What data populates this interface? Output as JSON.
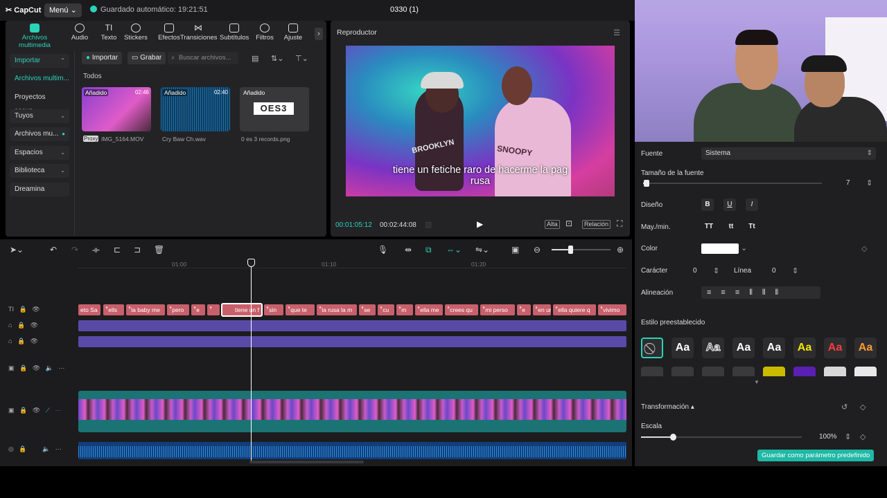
{
  "app": {
    "logo": "CapCut",
    "menu_label": "Menú",
    "autosave": "Guardado automático: 19:21:51",
    "project_name": "0330 (1)"
  },
  "toolbar": {
    "items": [
      {
        "label": "Archivos multimedia",
        "icon": "media-icon",
        "active": true
      },
      {
        "label": "Audio",
        "icon": "audio-icon"
      },
      {
        "label": "Texto",
        "icon": "text-icon"
      },
      {
        "label": "Stickers",
        "icon": "sticker-icon"
      },
      {
        "label": "Efectos",
        "icon": "effects-icon"
      },
      {
        "label": "Transiciones",
        "icon": "transitions-icon"
      },
      {
        "label": "Subtítulos",
        "icon": "subtitles-icon"
      },
      {
        "label": "Filtros",
        "icon": "filters-icon"
      },
      {
        "label": "Ajuste",
        "icon": "adjust-icon"
      }
    ],
    "next_arrow": "›"
  },
  "sidebar": {
    "items": [
      {
        "label": "Importar",
        "chev": "⌃"
      },
      {
        "label": "Archivos multim..."
      },
      {
        "label": "Proyectos secun..."
      },
      {
        "label": "Tuyos",
        "chev": "⌄"
      },
      {
        "label": "Archivos mu...",
        "chev": "●"
      },
      {
        "label": "Espacios",
        "chev": "⌄"
      },
      {
        "label": "Biblioteca",
        "chev": "⌄"
      },
      {
        "label": "Dreamina"
      }
    ]
  },
  "media": {
    "import_label": "Importar",
    "record_label": "Grabar",
    "search_placeholder": "Buscar archivos...",
    "section": "Todos",
    "files": [
      {
        "tag": "Añadido",
        "duration": "02:46",
        "name": "IMG_5164.MOV",
        "proxy": "Proxy"
      },
      {
        "tag": "Añadido",
        "duration": "02:40",
        "name": "Cry Baw Ch.wav"
      },
      {
        "tag": "Añadido",
        "name": "0 es 3 records.png",
        "logo_text": "OES3"
      }
    ]
  },
  "player": {
    "title": "Reproductor",
    "subtitle_line1": "tiene un fetiche raro de hacerme la pag",
    "subtitle_line2": "rusa",
    "shirt_text": "BROOKLYN",
    "shirt_text2": "SNOOPY",
    "current_time": "00:01:05:12",
    "total_time": "00:02:44:08",
    "quality_btn": "Alta",
    "ratio_btn": "Relación"
  },
  "timeline": {
    "ticks": [
      "01:00",
      "01:10",
      "01:20"
    ],
    "caption_segments": [
      "eto Sa",
      "ells",
      "la baby me",
      "pero",
      "e",
      "",
      "sin",
      "que te",
      "la rusa la m",
      "se",
      "cu",
      "m",
      "ella me",
      "crees qu",
      "mi perso",
      "e",
      "en un",
      "ella quiere q",
      "vivimo"
    ],
    "selected_segment": "tiene un f"
  },
  "properties": {
    "font_label": "Fuente",
    "font_value": "Sistema",
    "font_size_label": "Tamaño de la fuente",
    "font_size_value": "7",
    "font_size_fraction": 0.02,
    "style_label": "Diseño",
    "style_buttons": [
      "B",
      "U",
      "I"
    ],
    "case_label": "May./min.",
    "case_buttons": [
      "TT",
      "tt",
      "Tt"
    ],
    "color_label": "Color",
    "color_value": "#ffffff",
    "char_label": "Carácter",
    "char_value": "0",
    "line_label": "Línea",
    "line_value": "0",
    "align_label": "Alineación",
    "preset_label": "Estilo preestablecido",
    "presets": [
      {
        "text": "",
        "color": "#cccccc",
        "icon": "none-icon"
      },
      {
        "text": "Aa",
        "color": "#ffffff"
      },
      {
        "text": "Aa",
        "color": "#ffffff"
      },
      {
        "text": "Aa",
        "color": "#ffffff"
      },
      {
        "text": "Aa",
        "color": "#ffffff"
      },
      {
        "text": "Aa",
        "color": "#f5e400"
      },
      {
        "text": "Aa",
        "color": "#ff3c3c"
      },
      {
        "text": "Aa",
        "color": "#ff9b2f"
      }
    ],
    "transform_label": "Transformación",
    "scale_label": "Escala",
    "scale_value": "100%",
    "scale_fraction": 0.2,
    "save_preset": "Guardar como parámetro predefinido"
  },
  "colors": {
    "accent": "#2bd3b9",
    "caption_segment": "#c8606b",
    "purple_track": "#5a4aa8",
    "save_button": "#1fb9a6"
  }
}
